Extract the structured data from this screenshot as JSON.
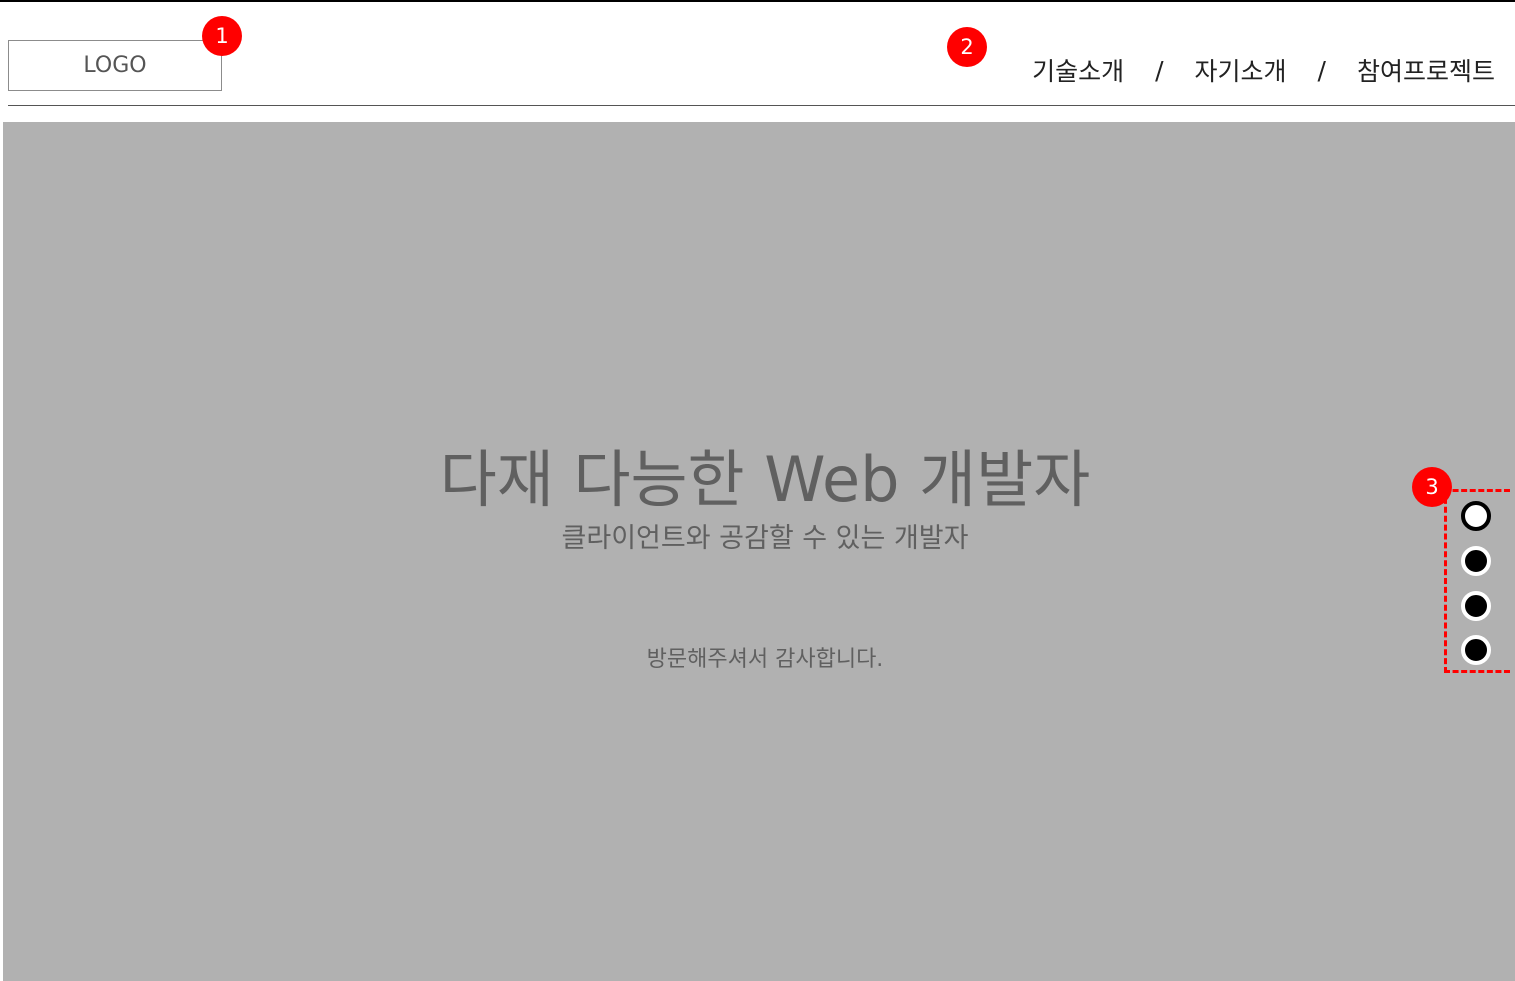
{
  "header": {
    "logo_label": "LOGO",
    "nav": {
      "items": [
        "기술소개",
        "자기소개",
        "참여프로젝트"
      ],
      "separator": "/"
    }
  },
  "hero": {
    "title": "다재 다능한 Web 개발자",
    "subtitle": "클라이언트와 공감할 수 있는 개발자",
    "message": "방문해주셔서 감사합니다."
  },
  "slide_indicator": {
    "count": 4,
    "active_index": 0
  },
  "annotations": [
    "1",
    "2",
    "3"
  ],
  "colors": {
    "hero_background": "#b1b1b1",
    "annotation": "#ff0000",
    "text": "#606060"
  }
}
